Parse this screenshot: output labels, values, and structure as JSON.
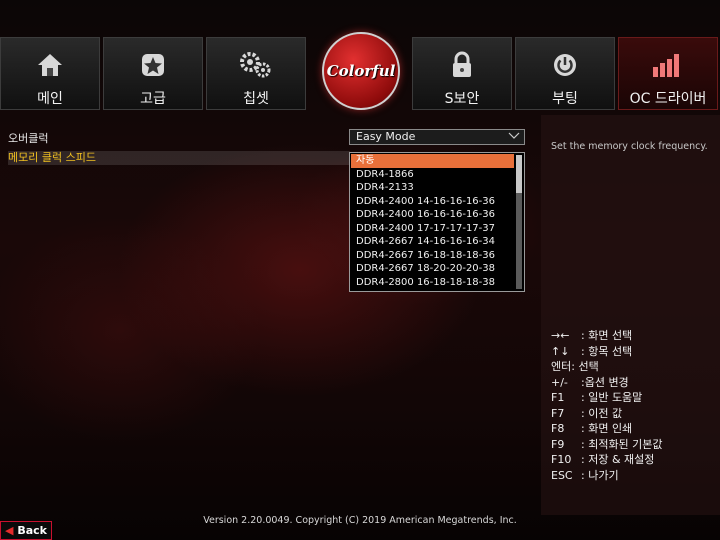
{
  "nav": {
    "tabs": [
      {
        "label": "메인",
        "icon": "home-icon"
      },
      {
        "label": "고급",
        "icon": "star-icon"
      },
      {
        "label": "칩셋",
        "icon": "gears-icon"
      },
      {
        "label": "S보안",
        "icon": "lock-icon"
      },
      {
        "label": "부팅",
        "icon": "power-icon"
      },
      {
        "label": "OC 드라이버",
        "icon": "bars-icon"
      }
    ],
    "logo_text": "Colorful"
  },
  "settings": {
    "overclock_label": "오버클럭",
    "overclock_value": "Easy Mode",
    "memory_speed_label": "메모리 클럭 스피드"
  },
  "dropdown": {
    "options": [
      "자동",
      "DDR4-1866",
      "DDR4-2133",
      "DDR4-2400 14-16-16-16-36",
      "DDR4-2400 16-16-16-16-36",
      "DDR4-2400 17-17-17-17-37",
      "DDR4-2667 14-16-16-16-34",
      "DDR4-2667 16-18-18-18-36",
      "DDR4-2667 18-20-20-20-38",
      "DDR4-2800 16-18-18-18-38"
    ],
    "selected_index": 0,
    "highlight_color": "#e8703a"
  },
  "help": {
    "text": "Set the memory clock frequency."
  },
  "keys": [
    {
      "key": "→←",
      "desc": ": 화면 선택"
    },
    {
      "key": "↑↓",
      "desc": ": 항목 선택"
    },
    {
      "key": "엔터",
      "desc": ": 선택"
    },
    {
      "key": "+/-",
      "desc": ":옵션 변경"
    },
    {
      "key": "F1",
      "desc": ": 일반 도움말"
    },
    {
      "key": "F7",
      "desc": ": 이전 값"
    },
    {
      "key": "F8",
      "desc": ": 화면 인쇄"
    },
    {
      "key": "F9",
      "desc": ": 최적화된 기본값"
    },
    {
      "key": "F10",
      "desc": ": 저장 & 재설정"
    },
    {
      "key": "ESC",
      "desc": ": 나가기"
    }
  ],
  "footer": {
    "version": "Version 2.20.0049. Copyright (C) 2019 American Megatrends, Inc.",
    "back_label": "Back"
  },
  "colors": {
    "accent_red": "#c8102e",
    "label_yellow": "#f0c020"
  }
}
